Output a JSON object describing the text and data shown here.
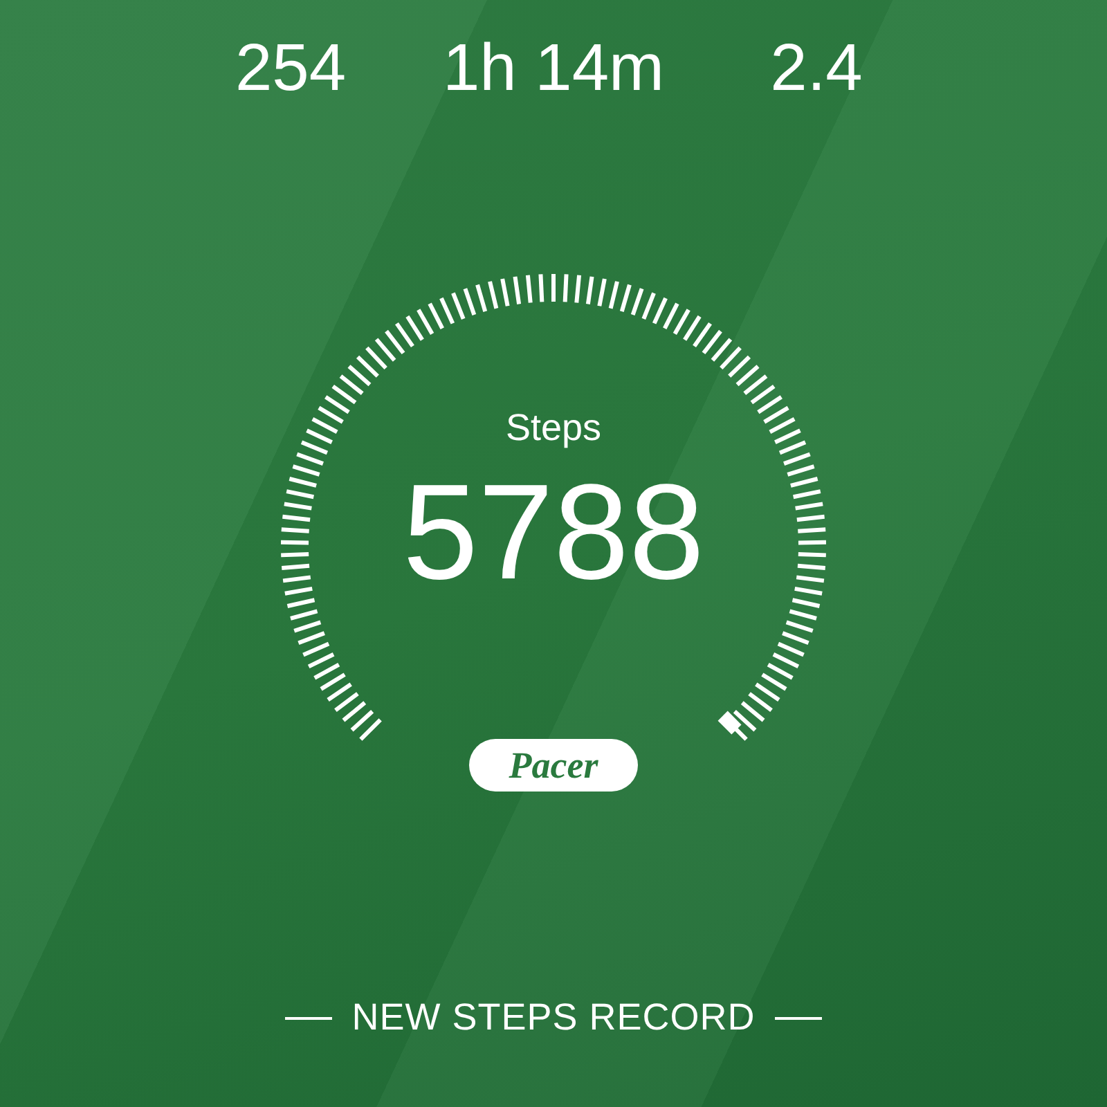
{
  "stats": [
    {
      "value": "254"
    },
    {
      "value": "1h 14m"
    },
    {
      "value": "2.4"
    }
  ],
  "gauge": {
    "label": "Steps",
    "value": "5788"
  },
  "brand": "Pacer",
  "record": "NEW STEPS RECORD"
}
